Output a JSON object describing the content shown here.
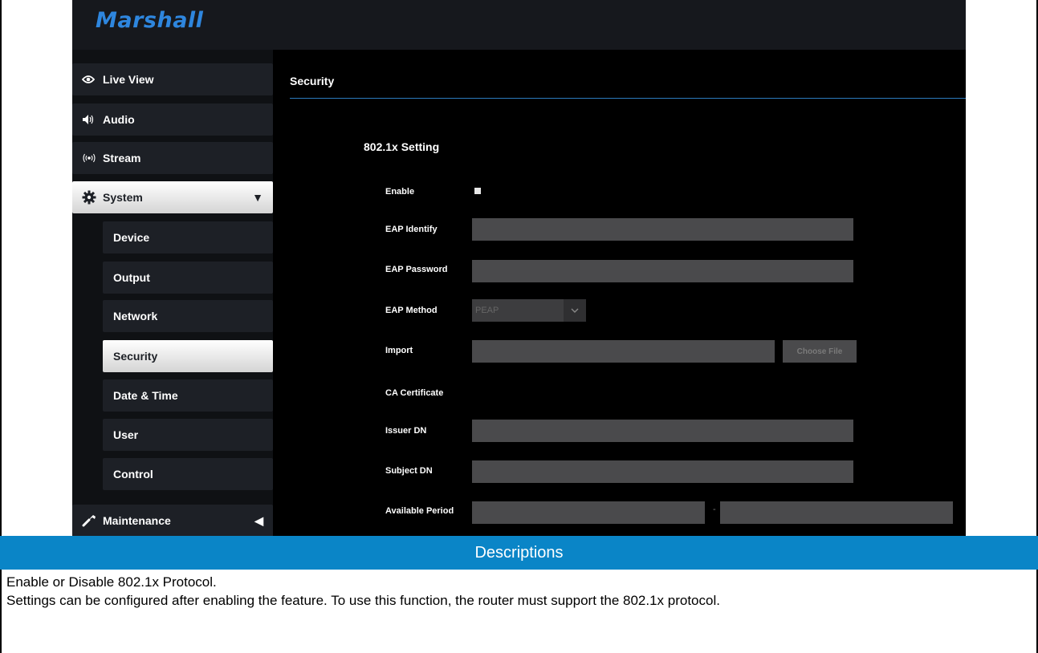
{
  "app": {
    "logo_text": "Marshall"
  },
  "sidebar": {
    "items": [
      {
        "label": "Live View",
        "icon": "eye-icon"
      },
      {
        "label": "Audio",
        "icon": "speaker-icon"
      },
      {
        "label": "Stream",
        "icon": "broadcast-icon"
      },
      {
        "label": "System",
        "icon": "gear-icon",
        "expanded": true,
        "arrow": "▼"
      },
      {
        "label": "Maintenance",
        "icon": "wrench-icon",
        "expanded": false,
        "arrow": "◀"
      }
    ],
    "system_sub_items": [
      {
        "label": "Device"
      },
      {
        "label": "Output"
      },
      {
        "label": "Network"
      },
      {
        "label": "Security",
        "active": true
      },
      {
        "label": "Date & Time"
      },
      {
        "label": "User"
      },
      {
        "label": "Control"
      }
    ]
  },
  "main": {
    "page_title": "Security",
    "section_title": "802.1x Setting",
    "fields": {
      "enable_label": "Enable",
      "eap_identify_label": "EAP Identify",
      "eap_identify_value": "",
      "eap_password_label": "EAP Password",
      "eap_password_value": "",
      "eap_method_label": "EAP Method",
      "eap_method_value": "PEAP",
      "import_label": "Import",
      "import_value": "",
      "choose_file_label": "Choose File",
      "ca_certificate_label": "CA Certificate",
      "issuer_dn_label": "Issuer DN",
      "issuer_dn_value": "",
      "subject_dn_label": "Subject DN",
      "subject_dn_value": "",
      "available_period_label": "Available Period",
      "available_period_from": "",
      "available_period_separator": "-",
      "available_period_to": ""
    }
  },
  "descriptions": {
    "header": "Descriptions",
    "lines": [
      "Enable or Disable 802.1x Protocol.",
      "Settings can be configured after enabling the feature. To use this function, the router must support the 802.1x protocol."
    ]
  },
  "colors": {
    "accent": "#0a85c7",
    "logo": "#2e86de",
    "sidebar_bg": "#1d2026",
    "field_bg": "#4a4a4c"
  }
}
